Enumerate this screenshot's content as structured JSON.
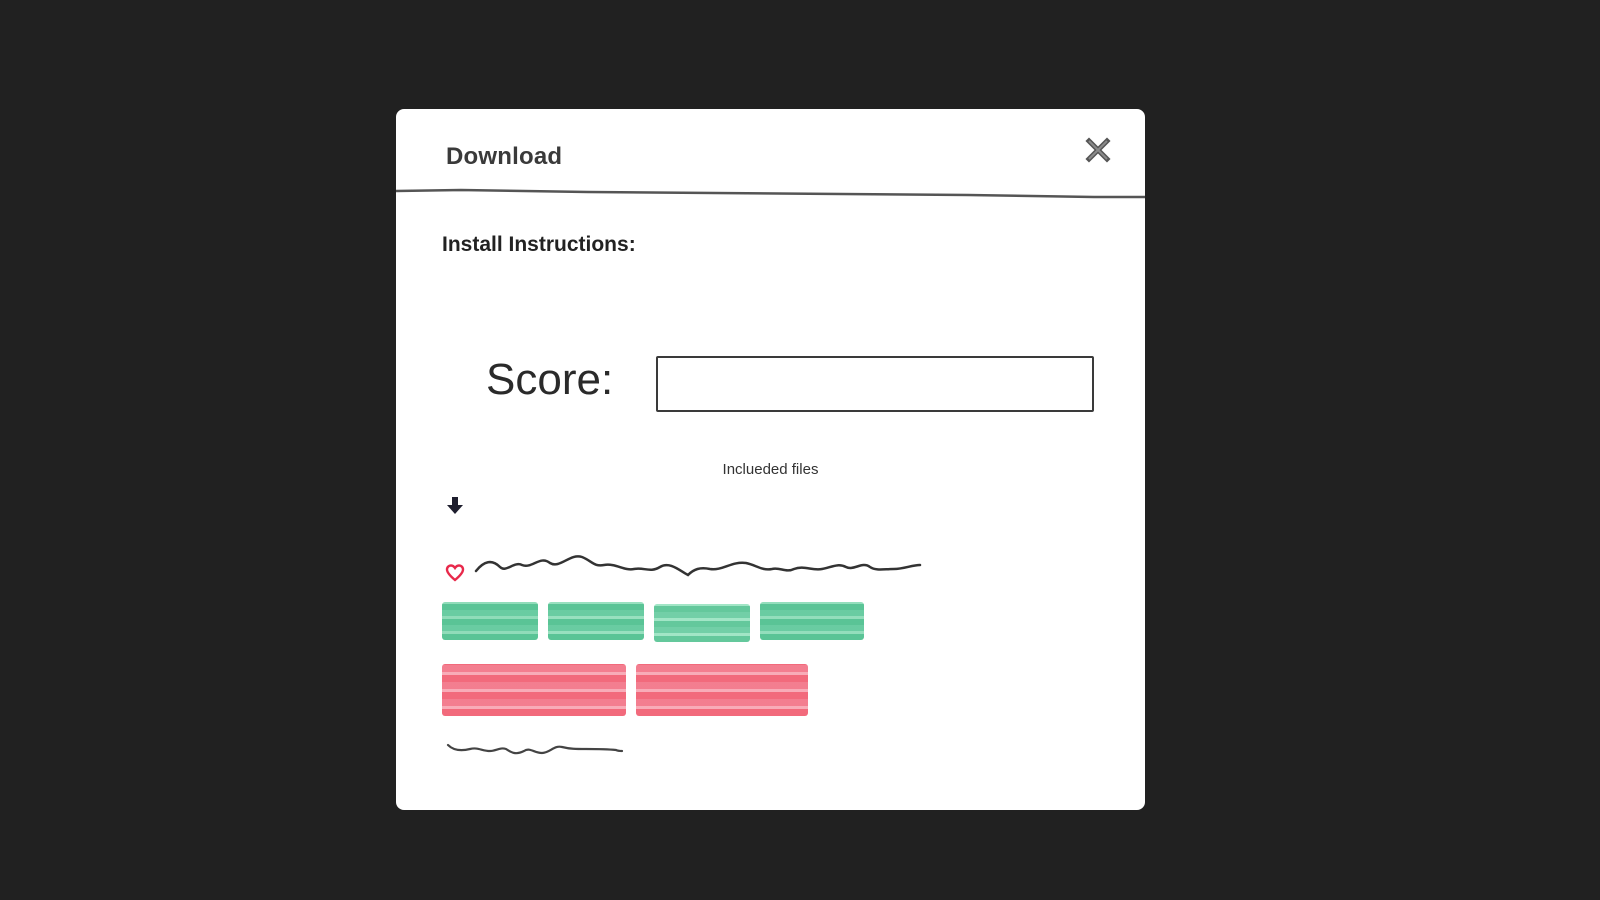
{
  "dialog": {
    "title": "Download",
    "close_icon": "close-icon"
  },
  "instructions": {
    "heading": "Install Instructions:"
  },
  "score": {
    "label": "Score:",
    "value": ""
  },
  "files": {
    "caption": "Inclueded files",
    "download_icon": "download-arrow-icon",
    "favorite_icon": "heart-icon"
  },
  "colors": {
    "backdrop": "#212121",
    "dialog": "#ffffff",
    "text": "#2a2a2a",
    "heart": "#e8294b",
    "green_redaction": "#3dba83",
    "red_redaction": "#f0596e"
  }
}
